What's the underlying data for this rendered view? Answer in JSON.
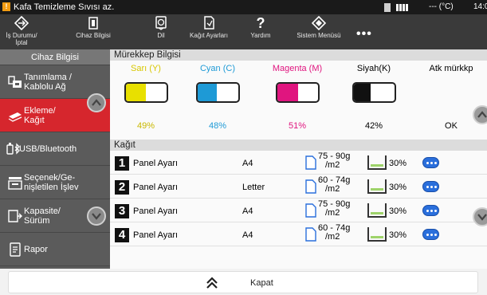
{
  "status_bar": {
    "message": "Kafa Temizleme Sıvısı az.",
    "warning_icon": "warning-icon",
    "temperature": "--- (°C)",
    "clock": "14:0"
  },
  "top_menu": {
    "items": [
      {
        "label_line1": "İş Durumu/",
        "label_line2": "İptal",
        "icon": "job-status-icon"
      },
      {
        "label_line1": "Cihaz Bilgisi",
        "label_line2": "",
        "icon": "device-info-icon"
      },
      {
        "label_line1": "Dil",
        "label_line2": "",
        "icon": "language-icon"
      },
      {
        "label_line1": "Kağıt Ayarları",
        "label_line2": "",
        "icon": "paper-settings-icon"
      },
      {
        "label_line1": "Yardım",
        "label_line2": "",
        "icon": "help-icon"
      },
      {
        "label_line1": "Sistem Menüsü",
        "label_line2": "",
        "icon": "system-menu-icon"
      }
    ],
    "more_label": "•••"
  },
  "sidebar": {
    "title": "Cihaz Bilgisi",
    "items": [
      {
        "label": "Tanımlama /\nKablolu Ağ",
        "icon": "identification-icon"
      },
      {
        "label": "Ekleme/\nKağıt",
        "icon": "paper-supply-icon"
      },
      {
        "label": "USB/Bluetooth",
        "icon": "usb-bluetooth-icon"
      },
      {
        "label": "Seçenek/Ge-\nnişletilen İşlev",
        "icon": "option-icon"
      },
      {
        "label": "Kapasite/\nSürüm",
        "icon": "capacity-icon"
      },
      {
        "label": "Rapor",
        "icon": "report-icon"
      }
    ]
  },
  "ink": {
    "title": "Mürekkep Bilgisi",
    "items": [
      {
        "name": "Sarı (Y)",
        "percent": "49%",
        "level": 0.49,
        "color": "#e8e000"
      },
      {
        "name": "Cyan (C)",
        "percent": "48%",
        "level": 0.48,
        "color": "#1e9ad6"
      },
      {
        "name": "Magenta (M)",
        "percent": "51%",
        "level": 0.51,
        "color": "#e0157f"
      },
      {
        "name": "Siyah(K)",
        "percent": "42%",
        "level": 0.42,
        "color": "#111111"
      },
      {
        "name": "Atk mürkkp",
        "percent": "OK",
        "color": "#222222"
      }
    ]
  },
  "paper": {
    "title": "Kağıt",
    "rows": [
      {
        "number": "1",
        "name": "Panel Ayarı",
        "size": "A4",
        "weight_line1": "75 - 90g",
        "weight_line2": "/m2",
        "tray_percent": "30%"
      },
      {
        "number": "2",
        "name": "Panel Ayarı",
        "size": "Letter",
        "weight_line1": "60 - 74g",
        "weight_line2": "/m2",
        "tray_percent": "30%"
      },
      {
        "number": "3",
        "name": "Panel Ayarı",
        "size": "A4",
        "weight_line1": "75 - 90g",
        "weight_line2": "/m2",
        "tray_percent": "30%"
      },
      {
        "number": "4",
        "name": "Panel Ayarı",
        "size": "A4",
        "weight_line1": "60 - 74g",
        "weight_line2": "/m2",
        "tray_percent": "30%"
      }
    ]
  },
  "bottom": {
    "close_label": "Kapat"
  },
  "colors": {
    "accent": "#d6262d",
    "more_button": "#2a6fdc"
  }
}
